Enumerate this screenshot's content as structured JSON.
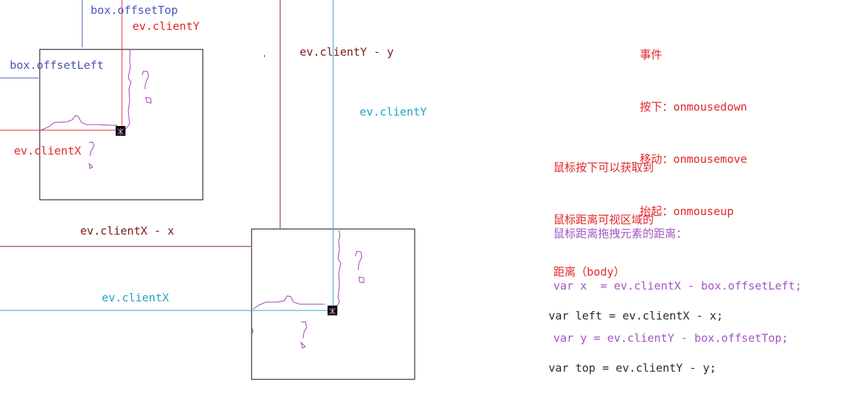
{
  "labels": {
    "top_offset_top": "box.offsetTop",
    "top_client_y": "ev.clientY",
    "top_offset_left": "box.offsetLeft",
    "top_client_x": "ev.clientX",
    "client_y_minus_y": "ev.clientY - y",
    "right_client_y": "ev.clientY",
    "client_x_minus_x": "ev.clientX - x",
    "bottom_client_x": "ev.clientX"
  },
  "notes": {
    "events": [
      "事件",
      "按下：onmousedown",
      "移动：onmousemove",
      "抬起：onmouseup"
    ],
    "mouse_position": [
      "鼠标按下可以获取到",
      "鼠标距离可视区域的",
      "距离（body）"
    ],
    "drag_offset": [
      "鼠标距离拖拽元素的距离：",
      "var x  = ev.clientX - box.offsetLeft;",
      "var y = ev.clientY - box.offsetTop;"
    ],
    "result": [
      "var left = ev.clientX - x;",
      "var top = ev.clientY - y;"
    ]
  },
  "colors": {
    "blue": "#4b54b9",
    "red": "#e3262a",
    "maroon": "#7a1a1a",
    "cyan": "#1fa3c8",
    "purple": "#a455c2",
    "box_border": "#000000"
  }
}
